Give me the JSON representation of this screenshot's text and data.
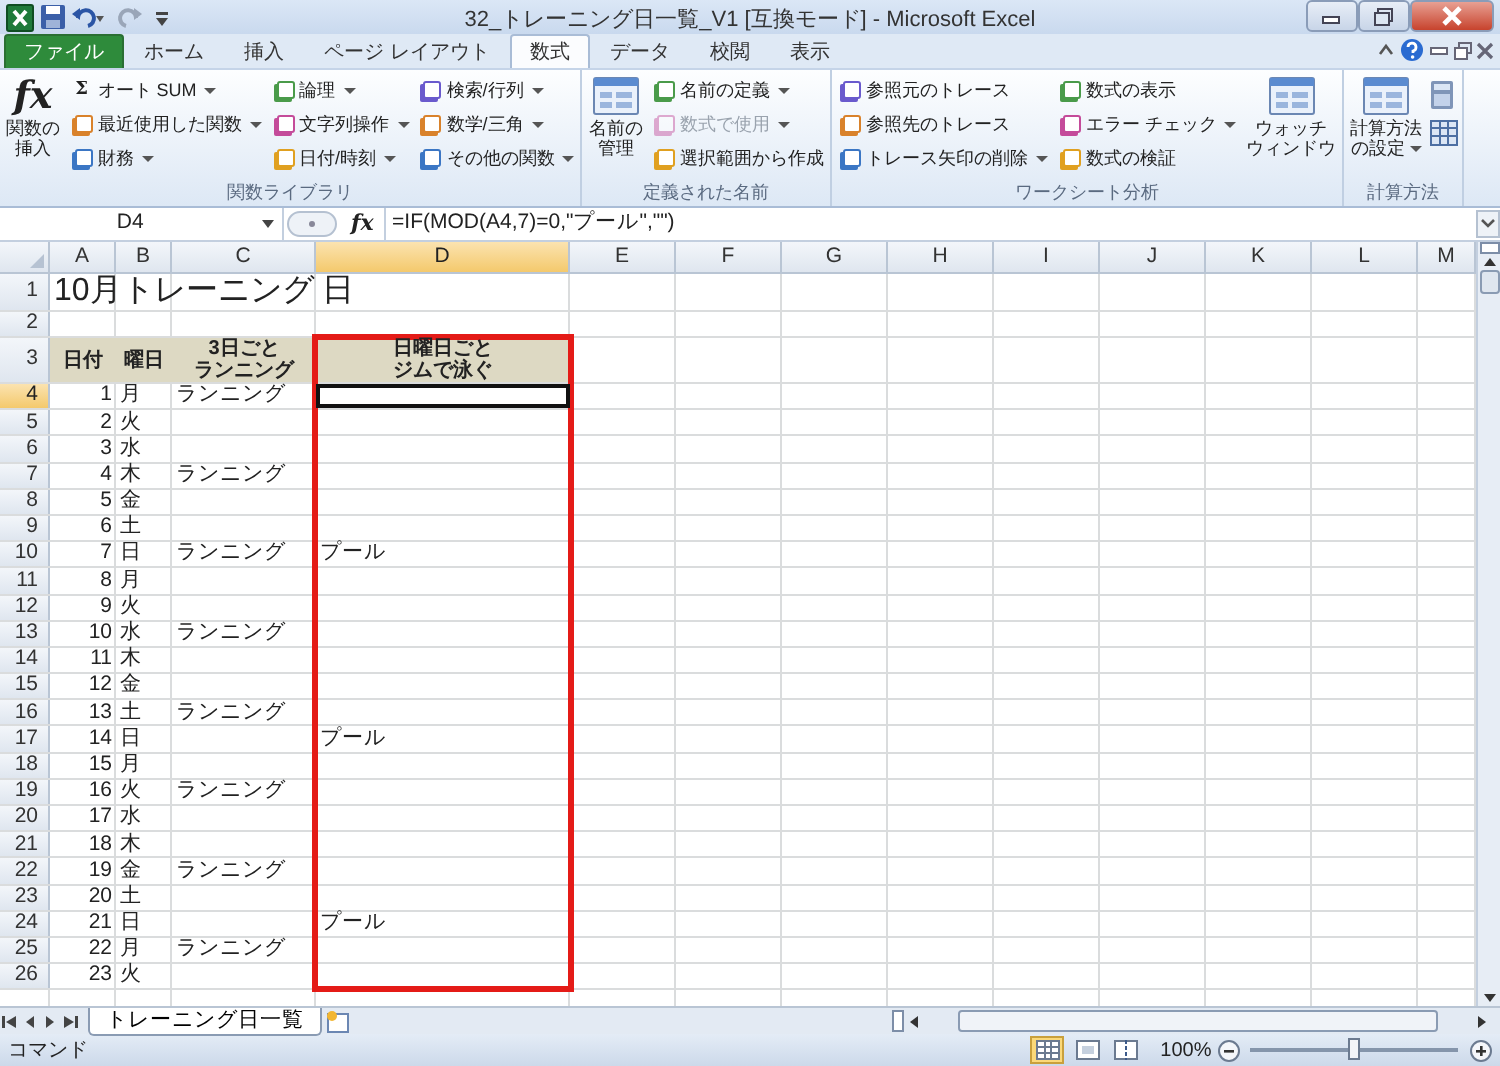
{
  "window": {
    "title": "32_トレーニング日一覧_V1 [互換モード] - Microsoft Excel"
  },
  "ribbon_tabs": [
    {
      "label": "ファイル",
      "kind": "file",
      "selected": false
    },
    {
      "label": "ホーム",
      "kind": "tab",
      "selected": false
    },
    {
      "label": "挿入",
      "kind": "tab",
      "selected": false
    },
    {
      "label": "ページ レイアウト",
      "kind": "tab",
      "selected": false
    },
    {
      "label": "数式",
      "kind": "tab",
      "selected": true
    },
    {
      "label": "データ",
      "kind": "tab",
      "selected": false
    },
    {
      "label": "校閲",
      "kind": "tab",
      "selected": false
    },
    {
      "label": "表示",
      "kind": "tab",
      "selected": false
    }
  ],
  "ribbon_groups": [
    {
      "label": "関数ライブラリ",
      "columns": [
        {
          "kind": "large",
          "icon_text": "fx",
          "lines": [
            "関数の",
            "挿入"
          ],
          "dropdown": false
        },
        {
          "kind": "small",
          "items": [
            {
              "glyph": "Σ",
              "label": "オート SUM",
              "dropdown": true,
              "disabled": false
            },
            {
              "label": "最近使用した関数",
              "dropdown": true,
              "disabled": false
            },
            {
              "label": "財務",
              "dropdown": true,
              "disabled": false
            }
          ]
        },
        {
          "kind": "small",
          "items": [
            {
              "label": "論理",
              "dropdown": true,
              "disabled": false
            },
            {
              "label": "文字列操作",
              "dropdown": true,
              "disabled": false
            },
            {
              "label": "日付/時刻",
              "dropdown": true,
              "disabled": false
            }
          ]
        },
        {
          "kind": "small",
          "items": [
            {
              "label": "検索/行列",
              "dropdown": true,
              "disabled": false
            },
            {
              "label": "数学/三角",
              "dropdown": true,
              "disabled": false
            },
            {
              "label": "その他の関数",
              "dropdown": true,
              "disabled": false
            }
          ]
        }
      ]
    },
    {
      "label": "定義された名前",
      "columns": [
        {
          "kind": "large",
          "lines": [
            "名前の",
            "管理"
          ],
          "dropdown": false
        },
        {
          "kind": "small",
          "items": [
            {
              "label": "名前の定義",
              "dropdown": true,
              "disabled": false
            },
            {
              "label": "数式で使用",
              "dropdown": true,
              "disabled": true
            },
            {
              "label": "選択範囲から作成",
              "dropdown": false,
              "disabled": false
            }
          ]
        }
      ]
    },
    {
      "label": "ワークシート分析",
      "columns": [
        {
          "kind": "small",
          "items": [
            {
              "label": "参照元のトレース",
              "dropdown": false,
              "disabled": false
            },
            {
              "label": "参照先のトレース",
              "dropdown": false,
              "disabled": false
            },
            {
              "label": "トレース矢印の削除",
              "dropdown": true,
              "disabled": false
            }
          ]
        },
        {
          "kind": "small",
          "items": [
            {
              "label": "数式の表示",
              "dropdown": false,
              "disabled": false
            },
            {
              "label": "エラー チェック",
              "dropdown": true,
              "disabled": false
            },
            {
              "label": "数式の検証",
              "dropdown": false,
              "disabled": false
            }
          ]
        },
        {
          "kind": "large",
          "lines": [
            "ウォッチ",
            "ウィンドウ"
          ],
          "dropdown": false
        }
      ]
    },
    {
      "label": "計算方法",
      "columns": [
        {
          "kind": "large",
          "lines": [
            "計算方法",
            "の設定"
          ],
          "dropdown": true
        },
        {
          "kind": "icons",
          "icons": [
            {
              "kind": "calculator"
            },
            {
              "kind": "sheet"
            }
          ]
        }
      ]
    }
  ],
  "formula_bar": {
    "name_box": "D4",
    "fx_label": "fx",
    "formula": "=IF(MOD(A4,7)=0,\"プール\",\"\")"
  },
  "columns": [
    {
      "label": "A",
      "selected": false,
      "framed": false
    },
    {
      "label": "B",
      "selected": false,
      "framed": false
    },
    {
      "label": "C",
      "selected": false,
      "framed": false
    },
    {
      "label": "D",
      "selected": true,
      "framed": true
    },
    {
      "label": "E",
      "selected": false,
      "framed": false
    },
    {
      "label": "F",
      "selected": false,
      "framed": false
    },
    {
      "label": "G",
      "selected": false,
      "framed": false
    },
    {
      "label": "H",
      "selected": false,
      "framed": false
    },
    {
      "label": "I",
      "selected": false,
      "framed": false
    },
    {
      "label": "J",
      "selected": false,
      "framed": false
    },
    {
      "label": "K",
      "selected": false,
      "framed": false
    },
    {
      "label": "L",
      "selected": false,
      "framed": false
    },
    {
      "label": "M",
      "selected": false,
      "framed": false
    }
  ],
  "rows": [
    {
      "number": "1",
      "kind": "title",
      "selected": false,
      "a": "10月トレーニング 日"
    },
    {
      "number": "2",
      "kind": "blank",
      "selected": false
    },
    {
      "number": "3",
      "kind": "header",
      "selected": false,
      "a": [
        "日付"
      ],
      "b": [
        "曜日"
      ],
      "c": [
        "3日ごと",
        "ランニング"
      ],
      "d": [
        "日曜日ごと",
        "ジムで泳ぐ"
      ]
    },
    {
      "number": "4",
      "kind": "data",
      "selected": true,
      "a": "1",
      "b": "月",
      "c": "ランニング"
    },
    {
      "number": "5",
      "kind": "data",
      "selected": false,
      "a": "2",
      "b": "火"
    },
    {
      "number": "6",
      "kind": "data",
      "selected": false,
      "a": "3",
      "b": "水"
    },
    {
      "number": "7",
      "kind": "data",
      "selected": false,
      "a": "4",
      "b": "木",
      "c": "ランニング"
    },
    {
      "number": "8",
      "kind": "data",
      "selected": false,
      "a": "5",
      "b": "金"
    },
    {
      "number": "9",
      "kind": "data",
      "selected": false,
      "a": "6",
      "b": "土"
    },
    {
      "number": "10",
      "kind": "data",
      "selected": false,
      "a": "7",
      "b": "日",
      "c": "ランニング",
      "d": "プール"
    },
    {
      "number": "11",
      "kind": "data",
      "selected": false,
      "a": "8",
      "b": "月"
    },
    {
      "number": "12",
      "kind": "data",
      "selected": false,
      "a": "9",
      "b": "火"
    },
    {
      "number": "13",
      "kind": "data",
      "selected": false,
      "a": "10",
      "b": "水",
      "c": "ランニング"
    },
    {
      "number": "14",
      "kind": "data",
      "selected": false,
      "a": "11",
      "b": "木"
    },
    {
      "number": "15",
      "kind": "data",
      "selected": false,
      "a": "12",
      "b": "金"
    },
    {
      "number": "16",
      "kind": "data",
      "selected": false,
      "a": "13",
      "b": "土",
      "c": "ランニング"
    },
    {
      "number": "17",
      "kind": "data",
      "selected": false,
      "a": "14",
      "b": "日",
      "d": "プール"
    },
    {
      "number": "18",
      "kind": "data",
      "selected": false,
      "a": "15",
      "b": "月"
    },
    {
      "number": "19",
      "kind": "data",
      "selected": false,
      "a": "16",
      "b": "火",
      "c": "ランニング"
    },
    {
      "number": "20",
      "kind": "data",
      "selected": false,
      "a": "17",
      "b": "水"
    },
    {
      "number": "21",
      "kind": "data",
      "selected": false,
      "a": "18",
      "b": "木"
    },
    {
      "number": "22",
      "kind": "data",
      "selected": false,
      "a": "19",
      "b": "金",
      "c": "ランニング"
    },
    {
      "number": "23",
      "kind": "data",
      "selected": false,
      "a": "20",
      "b": "土"
    },
    {
      "number": "24",
      "kind": "data",
      "selected": false,
      "a": "21",
      "b": "日",
      "d": "プール"
    },
    {
      "number": "25",
      "kind": "data",
      "selected": false,
      "a": "22",
      "b": "月",
      "c": "ランニング"
    },
    {
      "number": "26",
      "kind": "data",
      "selected": false,
      "a": "23",
      "b": "火"
    }
  ],
  "sheet_tabs": [
    {
      "label": "トレーニング日一覧",
      "selected": true
    }
  ],
  "status_bar": {
    "mode": "コマンド",
    "views": [
      {
        "kind": "normal",
        "selected": true
      },
      {
        "kind": "layout",
        "selected": false
      },
      {
        "kind": "pagebreak",
        "selected": false
      }
    ],
    "zoom": "100%",
    "zoom_slider": {
      "level": 0.5
    }
  }
}
